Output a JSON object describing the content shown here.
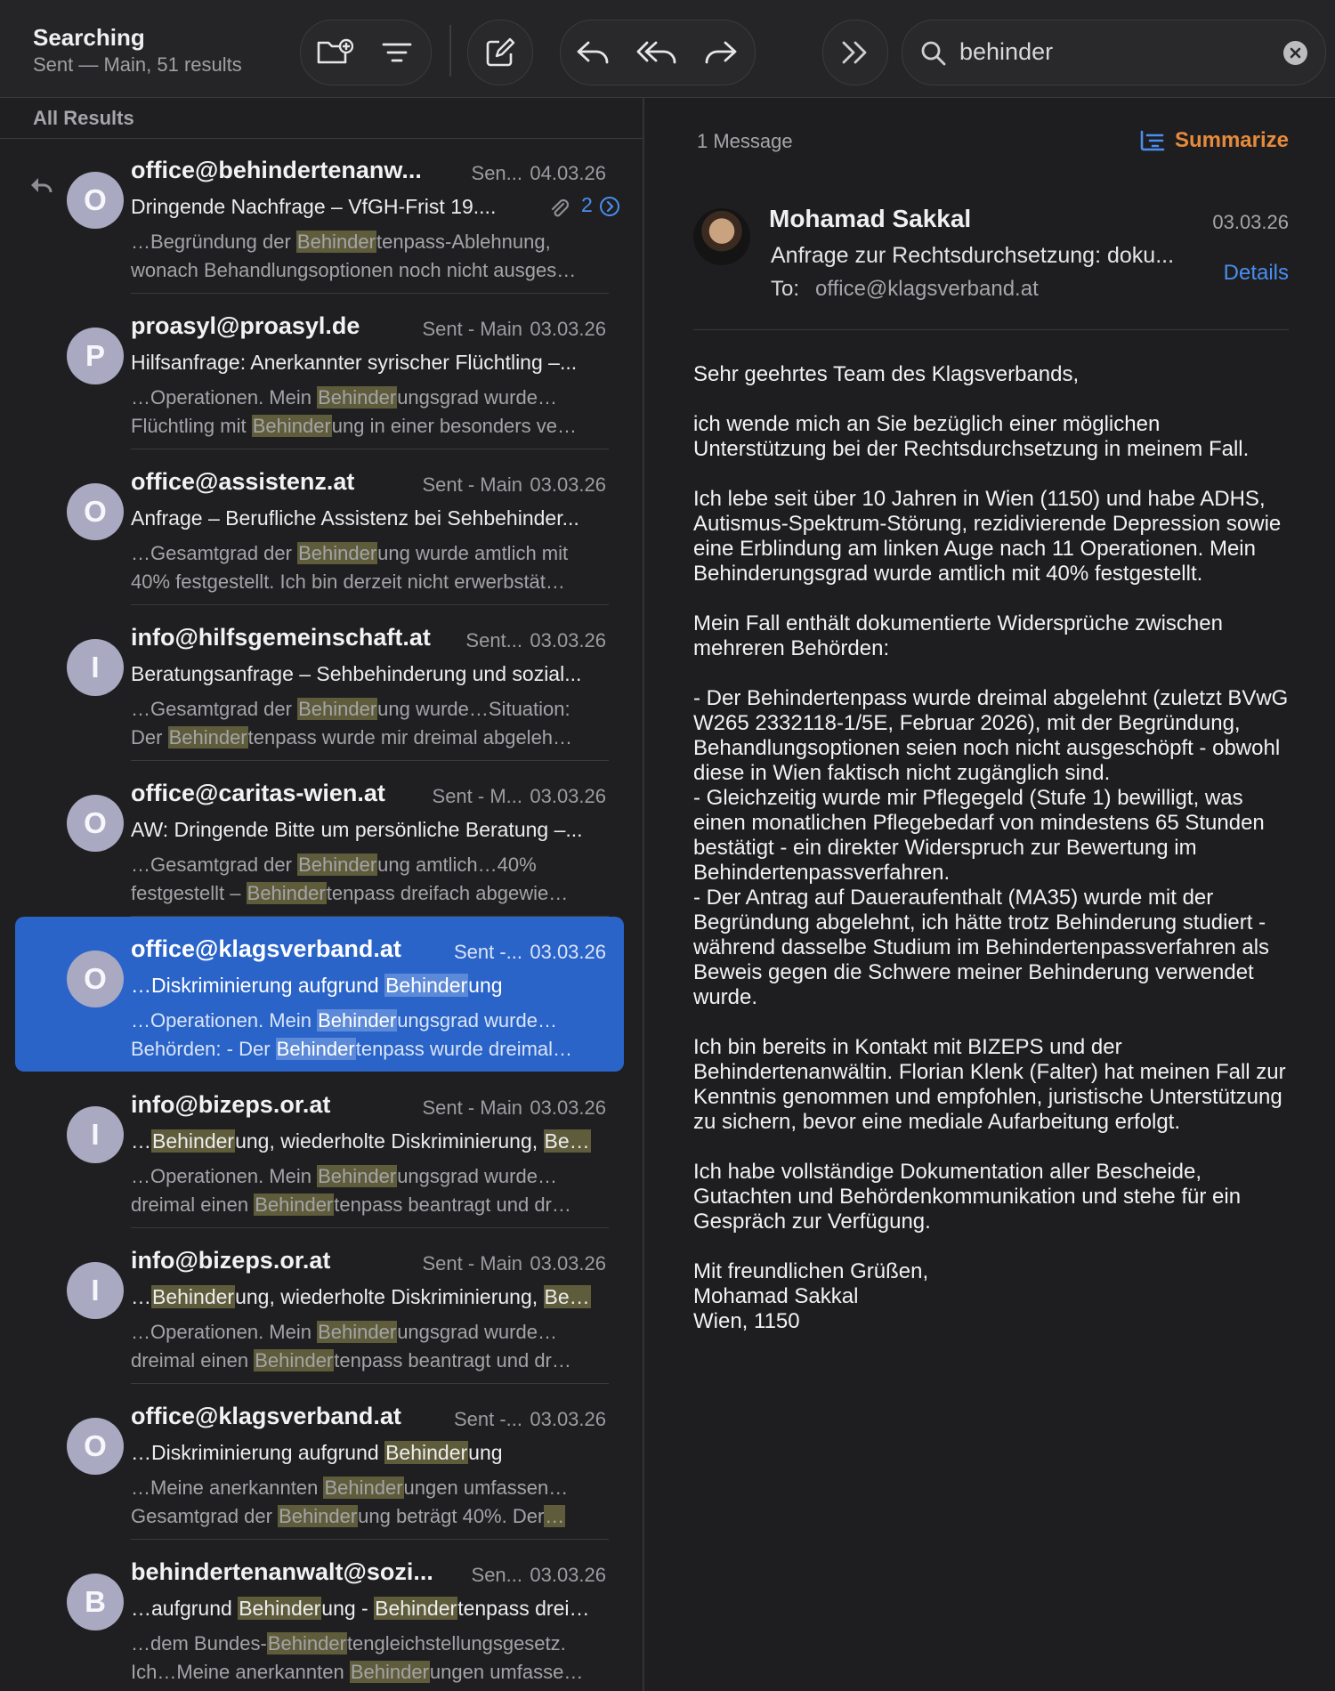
{
  "toolbar": {
    "title": "Searching",
    "subtitle": "Sent — Main, 51 results",
    "buttons": [
      "new-mailbox",
      "filter",
      "compose",
      "reply",
      "reply-all",
      "forward",
      "more"
    ]
  },
  "search": {
    "value": "behinder"
  },
  "list": {
    "header": "All Results",
    "items": [
      {
        "avatar": "O",
        "from": "office@behindertenanw...",
        "mailbox": "Sen...",
        "date": "04.03.26",
        "subject": "Dringende Nachfrage – VfGH-Frist 19....",
        "thread_count": "2",
        "preview1": [
          [
            "…Begründung der ",
            false
          ],
          [
            "Behinder",
            true
          ],
          [
            "tenpass-Ablehnung,",
            false
          ]
        ],
        "preview2": [
          [
            "wonach Behandlungsoptionen noch nicht ausges…",
            false
          ]
        ]
      },
      {
        "avatar": "P",
        "from": "proasyl@proasyl.de",
        "mailbox": "Sent - Main",
        "date": "03.03.26",
        "subject": "Hilfsanfrage: Anerkannter syrischer Flüchtling –...",
        "preview1": [
          [
            "…Operationen. Mein ",
            false
          ],
          [
            "Behinder",
            true
          ],
          [
            "ungsgrad wurde…",
            false
          ]
        ],
        "preview2": [
          [
            "Flüchtling mit ",
            false
          ],
          [
            "Behinder",
            true
          ],
          [
            "ung in einer besonders ve…",
            false
          ]
        ]
      },
      {
        "avatar": "O",
        "from": "office@assistenz.at",
        "mailbox": "Sent - Main",
        "date": "03.03.26",
        "subject": "Anfrage – Berufliche Assistenz bei Sehbehinder...",
        "preview1": [
          [
            "…Gesamtgrad der ",
            false
          ],
          [
            "Behinder",
            true
          ],
          [
            "ung wurde amtlich mit",
            false
          ]
        ],
        "preview2": [
          [
            "40% festgestellt. Ich bin derzeit nicht erwerbstät…",
            false
          ]
        ]
      },
      {
        "avatar": "I",
        "from": "info@hilfsgemeinschaft.at",
        "mailbox": "Sent...",
        "date": "03.03.26",
        "subject": "Beratungsanfrage – Sehbehinderung und sozial...",
        "preview1": [
          [
            "…Gesamtgrad der ",
            false
          ],
          [
            "Behinder",
            true
          ],
          [
            "ung wurde…Situation:",
            false
          ]
        ],
        "preview2": [
          [
            "Der ",
            false
          ],
          [
            "Behinder",
            true
          ],
          [
            "tenpass wurde mir dreimal abgeleh…",
            false
          ]
        ]
      },
      {
        "avatar": "O",
        "from": "office@caritas-wien.at",
        "mailbox": "Sent - M...",
        "date": "03.03.26",
        "subject": "AW: Dringende Bitte um persönliche Beratung –...",
        "preview1": [
          [
            "…Gesamtgrad der ",
            false
          ],
          [
            "Behinder",
            true
          ],
          [
            "ung amtlich…40%",
            false
          ]
        ],
        "preview2": [
          [
            "festgestellt – ",
            false
          ],
          [
            "Behinder",
            true
          ],
          [
            "tenpass dreifach abgewie…",
            false
          ]
        ]
      },
      {
        "avatar": "O",
        "from": "office@klagsverband.at",
        "mailbox": "Sent -...",
        "date": "03.03.26",
        "selected": true,
        "subject_parts": [
          [
            "…Diskriminierung aufgrund ",
            false
          ],
          [
            "Behinder",
            true
          ],
          [
            "ung",
            false
          ]
        ],
        "preview1": [
          [
            "…Operationen. Mein ",
            false
          ],
          [
            "Behinder",
            true
          ],
          [
            "ungsgrad wurde…",
            false
          ]
        ],
        "preview2": [
          [
            "Behörden: - Der ",
            false
          ],
          [
            "Behinder",
            true
          ],
          [
            "tenpass wurde dreimal…",
            false
          ]
        ]
      },
      {
        "avatar": "I",
        "from": "info@bizeps.or.at",
        "mailbox": "Sent - Main",
        "date": "03.03.26",
        "subject_parts": [
          [
            "…",
            false
          ],
          [
            "Behinder",
            true
          ],
          [
            "ung, wiederholte Diskriminierung, ",
            false
          ],
          [
            "Be…",
            true
          ]
        ],
        "preview1": [
          [
            "…Operationen. Mein ",
            false
          ],
          [
            "Behinder",
            true
          ],
          [
            "ungsgrad wurde…",
            false
          ]
        ],
        "preview2": [
          [
            "dreimal einen ",
            false
          ],
          [
            "Behinder",
            true
          ],
          [
            "tenpass beantragt und dr…",
            false
          ]
        ]
      },
      {
        "avatar": "I",
        "from": "info@bizeps.or.at",
        "mailbox": "Sent - Main",
        "date": "03.03.26",
        "subject_parts": [
          [
            "…",
            false
          ],
          [
            "Behinder",
            true
          ],
          [
            "ung, wiederholte Diskriminierung, ",
            false
          ],
          [
            "Be…",
            true
          ]
        ],
        "preview1": [
          [
            "…Operationen. Mein ",
            false
          ],
          [
            "Behinder",
            true
          ],
          [
            "ungsgrad wurde…",
            false
          ]
        ],
        "preview2": [
          [
            "dreimal einen ",
            false
          ],
          [
            "Behinder",
            true
          ],
          [
            "tenpass beantragt und dr…",
            false
          ]
        ]
      },
      {
        "avatar": "O",
        "from": "office@klagsverband.at",
        "mailbox": "Sent -...",
        "date": "03.03.26",
        "subject_parts": [
          [
            "…Diskriminierung aufgrund ",
            false
          ],
          [
            "Behinder",
            true
          ],
          [
            "ung",
            false
          ]
        ],
        "preview1": [
          [
            "…Meine anerkannten ",
            false
          ],
          [
            "Behinder",
            true
          ],
          [
            "ungen umfassen…",
            false
          ]
        ],
        "preview2": [
          [
            "Gesamtgrad der ",
            false
          ],
          [
            "Behinder",
            true
          ],
          [
            "ung beträgt 40%. Der",
            false
          ],
          [
            "…",
            true
          ]
        ]
      },
      {
        "avatar": "B",
        "from": "behindertenanwalt@sozi...",
        "mailbox": "Sen...",
        "date": "03.03.26",
        "subject_parts": [
          [
            "…aufgrund ",
            false
          ],
          [
            "Behinder",
            true
          ],
          [
            "ung - ",
            false
          ],
          [
            "Behinder",
            true
          ],
          [
            "tenpass drei…",
            false
          ]
        ],
        "preview1": [
          [
            "…dem Bundes-",
            false
          ],
          [
            "Behinder",
            true
          ],
          [
            "tengleichstellungsgesetz.",
            false
          ]
        ],
        "preview2": [
          [
            "Ich…Meine anerkannten ",
            false
          ],
          [
            "Behinder",
            true
          ],
          [
            "ungen umfasse…",
            false
          ]
        ]
      }
    ]
  },
  "reader": {
    "message_count": "1 Message",
    "summarize_label": "Summarize",
    "sender": "Mohamad Sakkal",
    "date": "03.03.26",
    "subject": "Anfrage zur Rechtsdurchsetzung: doku...",
    "details_label": "Details",
    "to_label": "To:",
    "to": "office@klagsverband.at",
    "body": [
      [
        "Sehr geehrtes Team des Klagsverbands,"
      ],
      [
        "ich wende mich an Sie bezüglich einer möglichen",
        "Unterstützung bei der Rechtsdurchsetzung in meinem Fall."
      ],
      [
        "Ich lebe seit über 10 Jahren in Wien (1150) und habe ADHS,",
        "Autismus-Spektrum-Störung, rezidivierende Depression sowie",
        "eine Erblindung am linken Auge nach 11 Operationen. Mein",
        "Behinderungsgrad wurde amtlich mit 40% festgestellt."
      ],
      [
        "Mein Fall enthält dokumentierte Widersprüche zwischen",
        "mehreren Behörden:"
      ],
      [
        "- Der Behindertenpass wurde dreimal abgelehnt (zuletzt BVwG",
        "W265 2332118-1/5E, Februar 2026), mit der Begründung,",
        "Behandlungsoptionen seien noch nicht ausgeschöpft - obwohl",
        "diese in Wien faktisch nicht zugänglich sind.",
        "- Gleichzeitig wurde mir Pflegegeld (Stufe 1) bewilligt, was",
        "einen monatlichen Pflegebedarf von mindestens 65 Stunden",
        "bestätigt - ein direkter Widerspruch zur Bewertung im",
        "Behindertenpassverfahren.",
        "- Der Antrag auf Daueraufenthalt (MA35) wurde mit der",
        "Begründung abgelehnt, ich hätte trotz Behinderung studiert -",
        "während dasselbe Studium im Behindertenpassverfahren als",
        "Beweis gegen die Schwere meiner Behinderung verwendet",
        "wurde."
      ],
      [
        "Ich bin bereits in Kontakt mit BIZEPS und der",
        "Behindertenanwältin. Florian Klenk (Falter) hat meinen Fall zur",
        "Kenntnis genommen und empfohlen, juristische Unterstützung",
        "zu sichern, bevor eine mediale Aufarbeitung erfolgt."
      ],
      [
        "Ich habe vollständige Dokumentation aller Bescheide,",
        "Gutachten und Behördenkommunikation und stehe für ein",
        "Gespräch zur Verfügung."
      ],
      [
        "Mit freundlichen Grüßen,",
        "Mohamad Sakkal",
        "Wien, 1150"
      ]
    ]
  }
}
